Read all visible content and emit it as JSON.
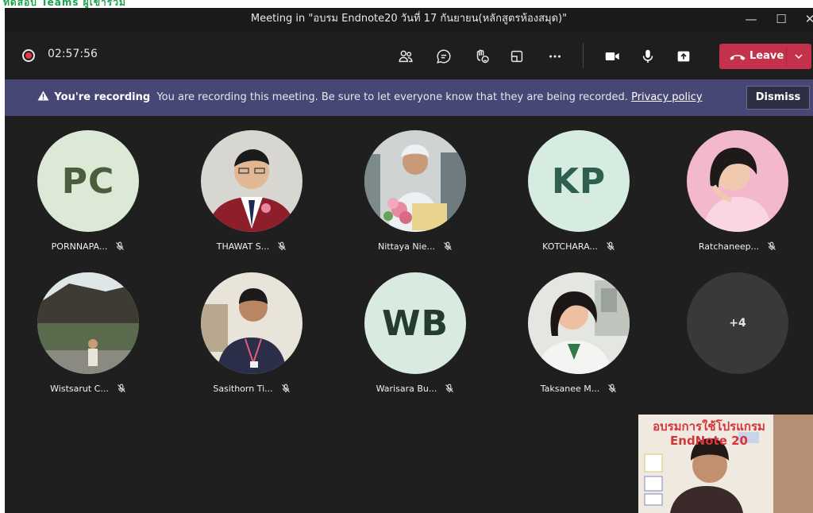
{
  "top_strip": {
    "text": "ทดสอบ Teams ผู้เข้าร่วม"
  },
  "window": {
    "title": "Meeting in \"อบรม Endnote20 วันที่ 17 กันยายน(หลักสูตรห้องสมุด)\"",
    "minimize": "—",
    "maximize": "☐",
    "close": "✕"
  },
  "toolbar": {
    "timer": "02:57:56",
    "leave_label": "Leave"
  },
  "banner": {
    "title": "You're recording",
    "message": "You are recording this meeting. Be sure to let everyone know that they are being recorded.",
    "link": "Privacy policy",
    "dismiss": "Dismiss"
  },
  "participants": [
    {
      "name": "PORNNAPA...",
      "initials": "PC"
    },
    {
      "name": "THAWAT S...",
      "initials": ""
    },
    {
      "name": "Nittaya Nie...",
      "initials": ""
    },
    {
      "name": "KOTCHARA...",
      "initials": "KP"
    },
    {
      "name": "Ratchaneep...",
      "initials": ""
    },
    {
      "name": "Wistsarut C...",
      "initials": ""
    },
    {
      "name": "Sasithorn Ti...",
      "initials": ""
    },
    {
      "name": "Warisara Bu...",
      "initials": "WB"
    },
    {
      "name": "Taksanee M...",
      "initials": ""
    },
    {
      "name": "",
      "initials": "+4"
    }
  ],
  "self_view": {
    "slide_title": "อบรมการใช้โปรแกรม EndNote 20"
  },
  "colors": {
    "leave": "#c4314b",
    "banner": "#464775",
    "background": "#201f1f",
    "recording_dot": "#e3344a"
  }
}
